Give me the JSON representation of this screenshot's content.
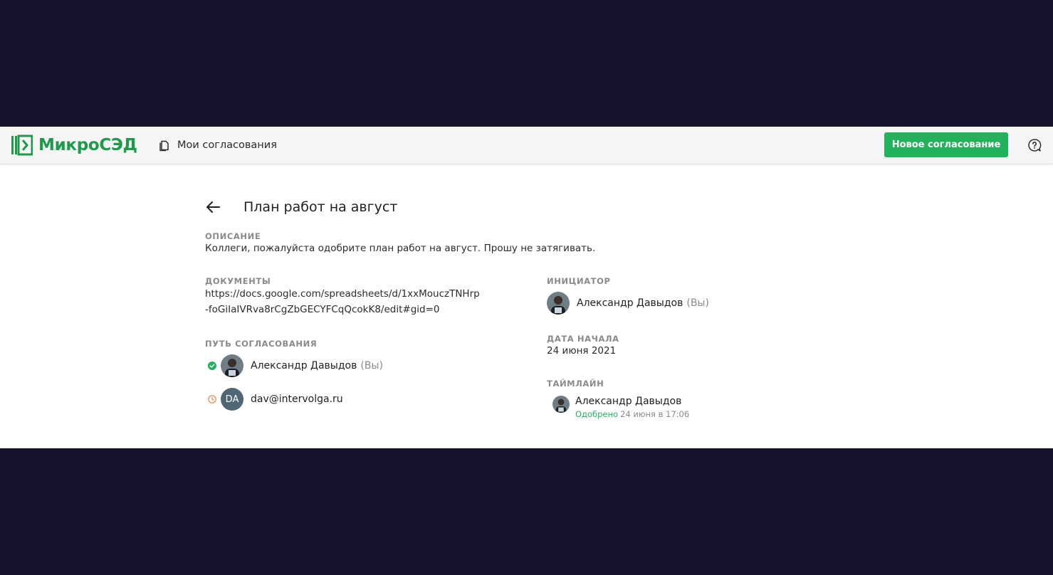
{
  "header": {
    "logo_text": "МикроСЭД",
    "nav_label": "Мои согласования",
    "new_button_label": "Новое согласование",
    "brand_color": "#1e9a4a",
    "accent_color": "#20b35c"
  },
  "page": {
    "title": "План работ на август"
  },
  "description": {
    "label": "ОПИСАНИЕ",
    "text": "Коллеги, пожалуйста одобрите план работ на август. Прошу не затягивать."
  },
  "documents": {
    "label": "ДОКУМЕНТЫ",
    "link": "https://docs.google.com/spreadsheets/d/1xxMouczTNHrp-foGiIaIVRva8rCgZbGECYFCqQcokK8/edit#gid=0"
  },
  "approval_path": {
    "label": "ПУТЬ СОГЛАСОВАНИЯ",
    "steps": [
      {
        "name": "Александр Давыдов",
        "suffix": "(Вы)",
        "status": "approved",
        "status_icon": "check-circle-icon"
      },
      {
        "name": "dav@intervolga.ru",
        "initials": "DA",
        "status": "pending",
        "status_icon": "clock-icon"
      }
    ]
  },
  "initiator": {
    "label": "ИНИЦИАТОР",
    "name": "Александр Давыдов",
    "suffix": "(Вы)"
  },
  "start_date": {
    "label": "ДАТА НАЧАЛА",
    "value": "24 июня 2021"
  },
  "timeline": {
    "label": "ТАЙМЛАЙН",
    "entries": [
      {
        "name": "Александр Давыдов",
        "status": "Одобрено",
        "time": "24 июня в 17:06"
      }
    ]
  }
}
